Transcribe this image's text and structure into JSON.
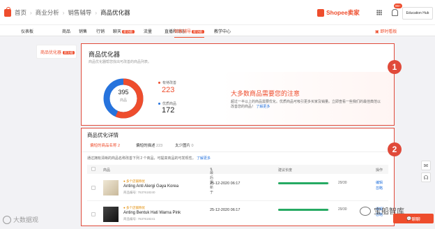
{
  "breadcrumb": {
    "home": "首页",
    "level1": "商业分析",
    "level2": "销售辅导",
    "current": "商品优化器"
  },
  "brand": {
    "name": "Shopee卖家"
  },
  "header": {
    "notif_count": "99+",
    "edu_hub": "Education Hub"
  },
  "nav": {
    "tabs": [
      {
        "label": "仪表板"
      },
      {
        "label": "商品"
      },
      {
        "label": "销售"
      },
      {
        "label": "行销"
      },
      {
        "label": "聊天",
        "badge": "新功能"
      },
      {
        "label": "流量"
      },
      {
        "label": "直播和动态"
      },
      {
        "label": "销售辅导",
        "badge": "新功能"
      },
      {
        "label": "教学中心"
      }
    ],
    "right_label": "即时看板"
  },
  "sidebar": {
    "item_label": "商品优化器",
    "item_badge": "新功能"
  },
  "summary": {
    "title": "商品优化器",
    "subtitle": "商品优化器帮您找出可改善的商品列表。",
    "total": "395",
    "total_label": "商品",
    "improve_label": "有待改善",
    "improve_value": "223",
    "good_label": "优质商品",
    "good_value": "172",
    "improve_share": 0.565,
    "colors": {
      "improve": "#ee4d2d",
      "good": "#2673dd"
    },
    "alert_title": "大多数商品需要您的注意",
    "alert_desc": "超过一半以上的商品需要优化。优质商品可吸引更多买家及销量。立即查看一些我们的最佳典范以改善您的商品！",
    "alert_link": "了解更多"
  },
  "detail": {
    "title": "商品优化详情",
    "subtabs": [
      {
        "label": "偏短的商品名称",
        "count": "2"
      },
      {
        "label": "偏短的描述",
        "count": "223"
      },
      {
        "label": "太少图片",
        "count": "0"
      }
    ],
    "desc": "通过拥有清晰的商品名称改善下列 2 个商品，可提高商品的可发现性。",
    "desc_link": "了解更多",
    "columns": {
      "product": "商品",
      "updated": "最后更新于",
      "score": "建议长度",
      "action": "操作"
    },
    "rows": [
      {
        "tag": "多个店铺称优",
        "name": "Anting Anti Alergi Gaya Korea",
        "id": "商品编号: 7637618240",
        "date": "25-12-2020 06:17",
        "score": "29/30",
        "fill": 0.97,
        "action1": "编辑",
        "action2": "忽略"
      },
      {
        "tag": "多个店铺称优",
        "name": "Anting Bentuk Hati Warna Pink",
        "id": "商品编号: 7637618241",
        "date": "25-12-2020 06:17",
        "score": "29/30",
        "fill": 0.97,
        "action1": "编辑",
        "action2": "忽略"
      }
    ]
  },
  "annotations": {
    "one": "1",
    "two": "2"
  },
  "watermarks": {
    "left": "大数据观",
    "right": "宝船智库"
  },
  "chat": {
    "label": "聊聊"
  }
}
